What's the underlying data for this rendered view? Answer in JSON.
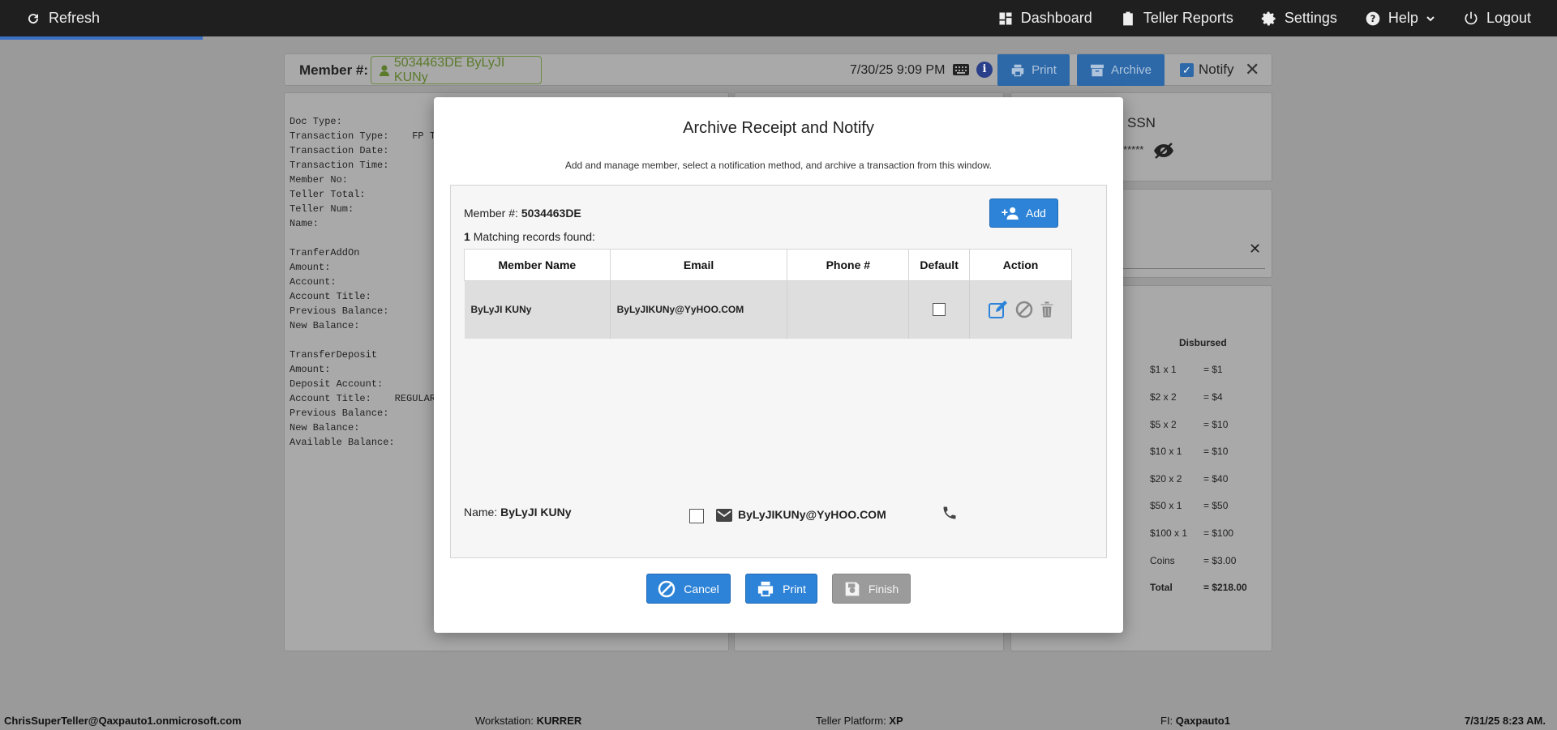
{
  "topbar": {
    "refresh": "Refresh",
    "nav": [
      {
        "label": "Dashboard",
        "icon": "dashboard-icon"
      },
      {
        "label": "Teller Reports",
        "icon": "clipboard-icon"
      },
      {
        "label": "Settings",
        "icon": "gear-icon"
      },
      {
        "label": "Help",
        "icon": "help-icon"
      },
      {
        "label": "Logout",
        "icon": "power-icon"
      }
    ]
  },
  "member_bar": {
    "label": "Member #:",
    "member": "5034463DE ByLyJI KUNy",
    "datetime": "7/30/25 9:09 PM",
    "print": "Print",
    "archive": "Archive",
    "notify": "Notify"
  },
  "receipt_lines": [
    "Doc Type:",
    "Transaction Type:    FP TRA",
    "Transaction Date:",
    "Transaction Time:",
    "Member No:                *",
    "Teller Total:",
    "Teller Num:",
    "Name:                    Ja",
    "",
    "TranferAddOn",
    "Amount:",
    "Account:                  *",
    "Account Title:",
    "Previous Balance:",
    "New Balance:",
    "",
    "TransferDeposit",
    "Amount:",
    "Deposit Account:",
    "Account Title:    REGULAR",
    "Previous Balance:         *",
    "New Balance:              *",
    "Available Balance:"
  ],
  "ssn": {
    "label": "SSN",
    "mask": "******"
  },
  "disbursed": {
    "header": "Disbursed",
    "rows": [
      {
        "d": "$1 x 1",
        "v": "= $1"
      },
      {
        "d": "$2 x 2",
        "v": "= $4"
      },
      {
        "d": "$5 x 2",
        "v": "= $10"
      },
      {
        "d": "$10 x 1",
        "v": "= $10"
      },
      {
        "d": "$20 x 2",
        "v": "= $40"
      },
      {
        "d": "$50 x 1",
        "v": "= $50"
      },
      {
        "d": "$100 x 1",
        "v": "= $100"
      },
      {
        "d": "Coins",
        "v": "= $3.00"
      }
    ],
    "total": {
      "d": "Total",
      "v": "= $218.00"
    }
  },
  "modal": {
    "title": "Archive Receipt and Notify",
    "subtitle": "Add and manage member, select a notification method, and archive a transaction from this window.",
    "member_label": "Member #:",
    "member_value": "5034463DE",
    "match_count": "1",
    "match_text": "Matching records found:",
    "add": "Add",
    "columns": [
      "Member Name",
      "Email",
      "Phone #",
      "Default",
      "Action"
    ],
    "rows": [
      {
        "name": "ByLyJI KUNy",
        "email": "ByLyJIKUNy@YyHOO.COM",
        "phone": ""
      }
    ],
    "name_label": "Name:",
    "name_value": "ByLyJI KUNy",
    "notify_email": "ByLyJIKUNy@YyHOO.COM",
    "cancel": "Cancel",
    "print": "Print",
    "finish": "Finish"
  },
  "status": {
    "user": "ChrisSuperTeller@Qaxpauto1.onmicrosoft.com",
    "workstation_label": "Workstation:",
    "workstation": "KURRER",
    "platform_label": "Teller Platform:",
    "platform": "XP",
    "fi_label": "FI:",
    "fi": "Qaxpauto1",
    "datetime": "7/31/25 8:23 AM."
  },
  "colors": {
    "accent": "#2d83d7",
    "topbar": "#1f1f1f",
    "overlay": "#9a9a9a",
    "member_green": "#5b7a2a"
  }
}
